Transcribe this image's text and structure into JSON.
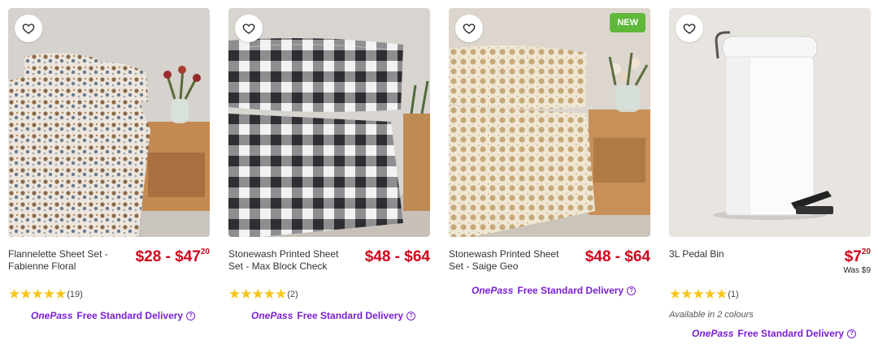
{
  "products": [
    {
      "title": "Flannelette Sheet Set - Fabienne Floral",
      "price_main": "$28 - $47",
      "price_cents": "20",
      "rating_stars": "★★★★★",
      "rating_count": "(19)",
      "delivery_brand": "OnePass",
      "delivery_text": "Free Standard Delivery"
    },
    {
      "title": "Stonewash Printed Sheet Set - Max Block Check",
      "price_main": "$48 - $64",
      "rating_stars": "★★★★★",
      "rating_count": "(2)",
      "delivery_brand": "OnePass",
      "delivery_text": "Free Standard Delivery"
    },
    {
      "title": "Stonewash Printed Sheet Set - Saige Geo",
      "price_main": "$48 - $64",
      "badge": "NEW",
      "delivery_brand": "OnePass",
      "delivery_text": "Free Standard Delivery"
    },
    {
      "title": "3L Pedal Bin",
      "price_main": "$7",
      "price_cents": "20",
      "was_price": "Was $9",
      "rating_stars": "★★★★★",
      "rating_count": "(1)",
      "availability": "Available in 2 colours",
      "delivery_brand": "OnePass",
      "delivery_text": "Free Standard Delivery"
    }
  ],
  "icons": {
    "wishlist": "heart-outline-icon",
    "info": "info-circle-icon"
  },
  "colors": {
    "price": "#d0021b",
    "onepass": "#7a1fd2",
    "new_badge": "#5fb83a",
    "star": "#f5c518"
  }
}
